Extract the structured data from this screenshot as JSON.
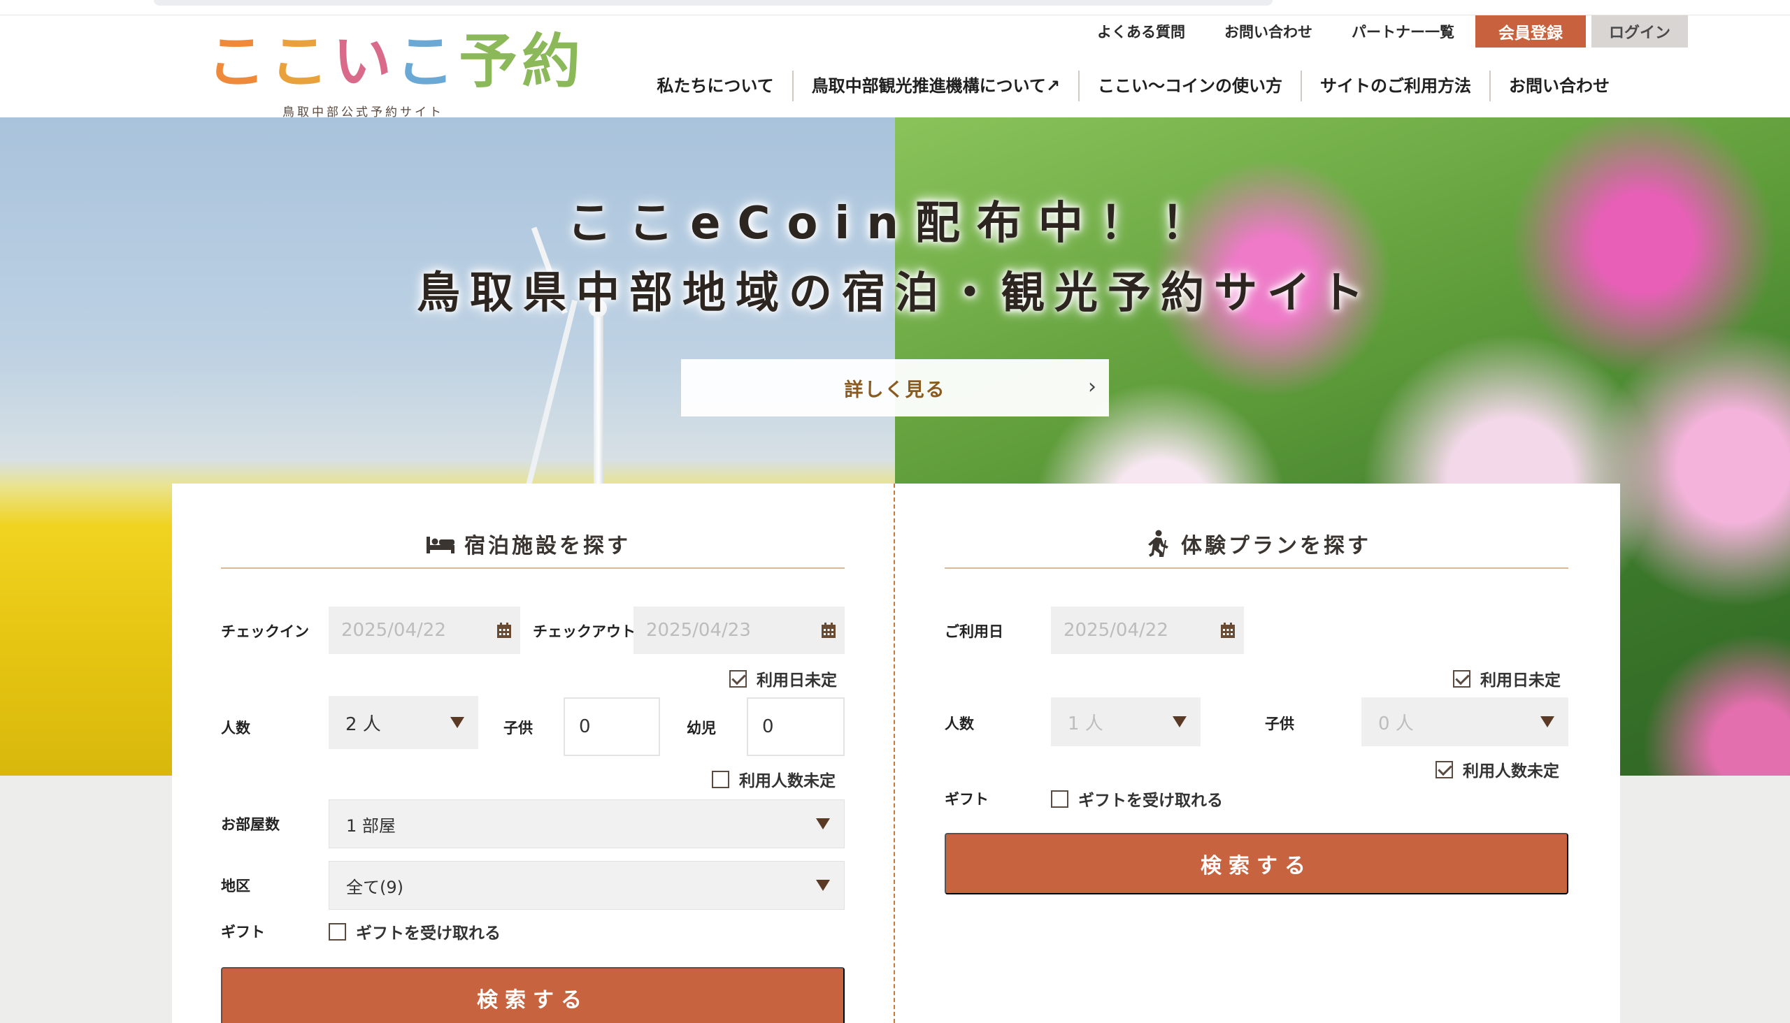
{
  "logo": {
    "title_parts": [
      "こ",
      "こ",
      "い",
      "こ",
      "予約"
    ],
    "subtitle": "鳥取中部公式予約サイト"
  },
  "util_nav": {
    "faq": "よくある質問",
    "contact": "お問い合わせ",
    "partners": "パートナー一覧",
    "register": "会員登録",
    "login": "ログイン"
  },
  "main_nav": [
    {
      "label": "私たちについて"
    },
    {
      "label": "鳥取中部観光推進機構について↗"
    },
    {
      "label": "ここい〜コインの使い方"
    },
    {
      "label": "サイトのご利用方法"
    },
    {
      "label": "お問い合わせ"
    }
  ],
  "hero": {
    "line1": "ここeCoin配布中！！",
    "line2": "鳥取県中部地域の宿泊・観光予約サイト",
    "more_button": "詳しく見る",
    "more_arrow": "›"
  },
  "lodging": {
    "title": "宿泊施設を探す",
    "checkin_label": "チェックイン",
    "checkin_value": "2025/04/22",
    "checkout_label": "チェックアウト",
    "checkout_value": "2025/04/23",
    "date_undecided": "利用日未定",
    "guests_label": "人数",
    "guests_value": "2 人",
    "children_label": "子供",
    "children_value": "0",
    "infants_label": "幼児",
    "infants_value": "0",
    "guests_undecided": "利用人数未定",
    "rooms_label": "お部屋数",
    "rooms_value": "1 部屋",
    "area_label": "地区",
    "area_value": "全て(9)",
    "gift_label": "ギフト",
    "gift_option": "ギフトを受け取れる",
    "search_button": "検索する"
  },
  "experience": {
    "title": "体験プランを探す",
    "date_label": "ご利用日",
    "date_value": "2025/04/22",
    "date_undecided": "利用日未定",
    "guests_label": "人数",
    "guests_value": "1 人",
    "children_label": "子供",
    "children_value": "0 人",
    "guests_undecided": "利用人数未定",
    "gift_label": "ギフト",
    "gift_option": "ギフトを受け取れる",
    "search_button": "検索する"
  },
  "colors": {
    "accent": "#c8633f",
    "rule": "#d9b898"
  },
  "icons": {
    "calendar": "calendar-icon",
    "bed": "bed-icon",
    "hiker": "hiker-icon",
    "dropdown": "triangle-down-icon"
  }
}
